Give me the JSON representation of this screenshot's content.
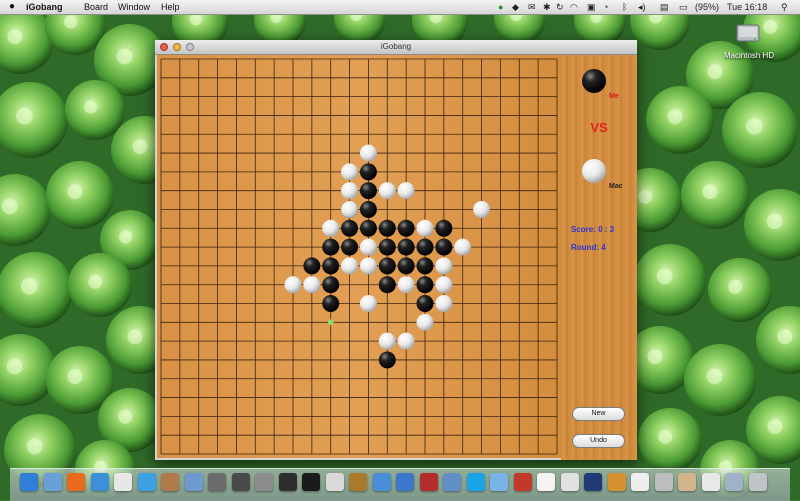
{
  "menubar": {
    "app_name": "iGobang",
    "menus": [
      "Board",
      "Window",
      "Help"
    ],
    "battery": "(95%)",
    "clock": "Tue 16:18"
  },
  "desktop": {
    "hd_label": "Macintosh HD"
  },
  "window": {
    "title": "iGobang"
  },
  "panel": {
    "player_label": "Me",
    "vs_label": "VS",
    "opponent_label": "Mac",
    "score": "Score:   0 : 3",
    "round": "Round:  4",
    "new_button": "New",
    "undo_button": "Undo"
  },
  "board": {
    "lines": 22,
    "color": "#d9934a",
    "stones": {
      "black": [
        [
          11,
          6
        ],
        [
          11,
          7
        ],
        [
          10,
          8
        ],
        [
          11,
          8
        ],
        [
          10,
          9
        ],
        [
          11,
          9
        ],
        [
          12,
          9
        ],
        [
          13,
          9
        ],
        [
          15,
          9
        ],
        [
          9,
          10
        ],
        [
          10,
          10
        ],
        [
          12,
          10
        ],
        [
          13,
          10
        ],
        [
          14,
          10
        ],
        [
          15,
          10
        ],
        [
          8,
          11
        ],
        [
          9,
          11
        ],
        [
          12,
          11
        ],
        [
          13,
          11
        ],
        [
          14,
          11
        ],
        [
          9,
          12
        ],
        [
          12,
          12
        ],
        [
          14,
          12
        ],
        [
          9,
          13
        ],
        [
          14,
          13
        ],
        [
          12,
          16
        ]
      ],
      "white": [
        [
          11,
          5
        ],
        [
          10,
          6
        ],
        [
          10,
          7
        ],
        [
          12,
          7
        ],
        [
          13,
          7
        ],
        [
          10,
          8
        ],
        [
          17,
          8
        ],
        [
          9,
          9
        ],
        [
          14,
          9
        ],
        [
          11,
          10
        ],
        [
          16,
          10
        ],
        [
          10,
          11
        ],
        [
          11,
          11
        ],
        [
          15,
          11
        ],
        [
          7,
          12
        ],
        [
          8,
          12
        ],
        [
          13,
          12
        ],
        [
          15,
          12
        ],
        [
          11,
          13
        ],
        [
          15,
          13
        ],
        [
          14,
          14
        ],
        [
          12,
          15
        ],
        [
          13,
          15
        ]
      ]
    },
    "marker": [
      9,
      14
    ],
    "marker_color": "#9ad36a"
  },
  "dock": {
    "icons": [
      "finder",
      "mail",
      "firefox",
      "network",
      "calendar",
      "itunes",
      "contacts",
      "preview",
      "photos",
      "dashboard",
      "systemprefs",
      "activity",
      "terminal",
      "console",
      "xcode",
      "games",
      "safari",
      "photobooth",
      "utilities",
      "skype",
      "messages",
      "dictionary",
      "notes",
      "docs",
      "photoshop",
      "weather",
      "textedit",
      "apps",
      "stack",
      "documents",
      "downloads",
      "trash"
    ]
  }
}
